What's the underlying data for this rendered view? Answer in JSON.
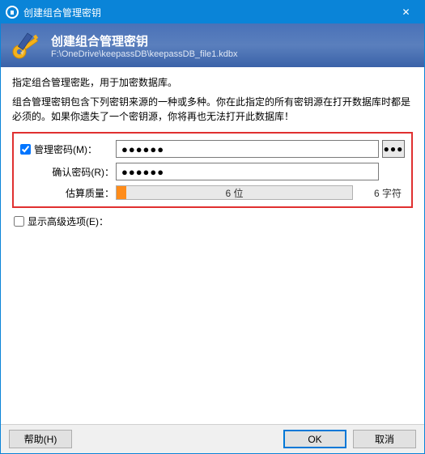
{
  "window": {
    "title": "创建组合管理密钥",
    "close": "✕"
  },
  "banner": {
    "title": "创建组合管理密钥",
    "path": "F:\\OneDrive\\keepassDB\\keepassDB_file1.kdbx"
  },
  "desc": {
    "line1": "指定组合管理密匙，用于加密数据库。",
    "line2": "组合管理密钥包含下列密钥来源的一种或多种。你在此指定的所有密钥源在打开数据库时都是必须的。如果你遗失了一个密钥源，你将再也无法打开此数据库！"
  },
  "labels": {
    "master_pw": "管理密码(M)：",
    "confirm_pw": "确认密码(R)：",
    "quality": "估算质量：",
    "adv_options": "显示高级选项(E)："
  },
  "fields": {
    "master_pw_value": "●●●●●●",
    "confirm_pw_value": "●●●●●●",
    "dots_button": "●●●"
  },
  "quality": {
    "bits": "6 位",
    "chars": "6 字符"
  },
  "buttons": {
    "help": "帮助(H)",
    "ok": "OK",
    "cancel": "取消"
  }
}
